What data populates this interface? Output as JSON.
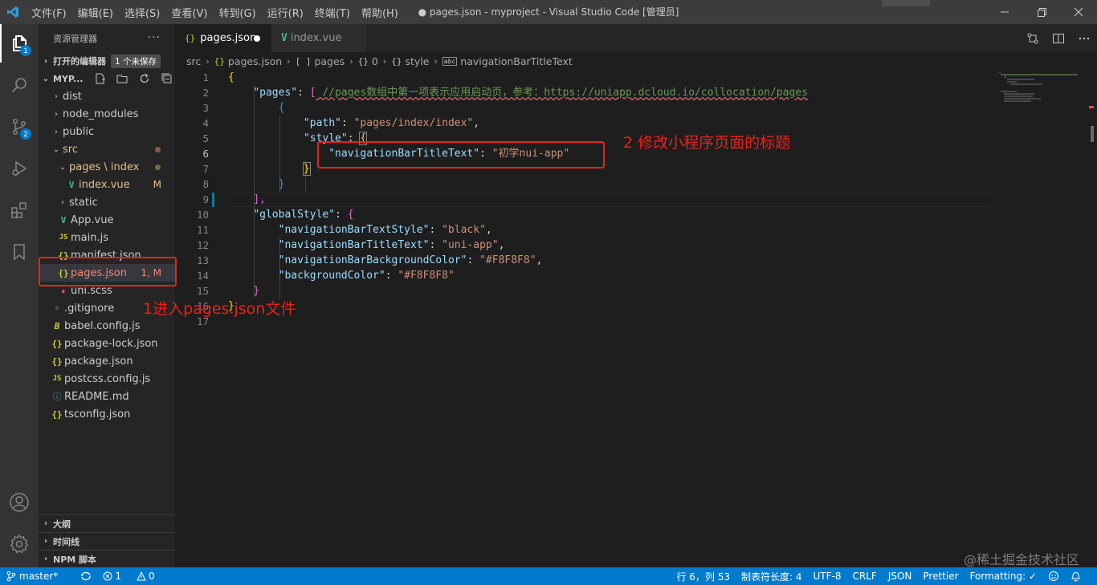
{
  "window": {
    "title": "● pages.json - myproject - Visual Studio Code [管理员]",
    "menu": [
      "文件(F)",
      "编辑(E)",
      "选择(S)",
      "查看(V)",
      "转到(G)",
      "运行(R)",
      "终端(T)",
      "帮助(H)"
    ]
  },
  "activitybar": {
    "explorer_badge": "1",
    "scm_badge": "2"
  },
  "sidebar": {
    "header": "资源管理器",
    "more": "···",
    "open_editors_label": "打开的编辑器",
    "unsaved_badge": "1 个未保存",
    "project_label": "MYP...",
    "tree": [
      {
        "label": "dist",
        "arrow": "›",
        "icon": "",
        "status": ""
      },
      {
        "label": "node_modules",
        "arrow": "›",
        "icon": "",
        "status": ""
      },
      {
        "label": "public",
        "arrow": "›",
        "icon": "",
        "status": ""
      },
      {
        "label": "src",
        "arrow": "⌄",
        "icon": "",
        "status": ""
      },
      {
        "label": "pages \\ index",
        "arrow": "⌄",
        "icon": "",
        "status": ""
      },
      {
        "label": "index.vue",
        "arrow": "",
        "icon": "V",
        "status": "M"
      },
      {
        "label": "static",
        "arrow": "›",
        "icon": "",
        "status": ""
      },
      {
        "label": "App.vue",
        "arrow": "",
        "icon": "V",
        "status": ""
      },
      {
        "label": "main.js",
        "arrow": "",
        "icon": "JS",
        "status": ""
      },
      {
        "label": "manifest.json",
        "arrow": "",
        "icon": "{}",
        "status": ""
      },
      {
        "label": "pages.json",
        "arrow": "",
        "icon": "{}",
        "status": "1, M"
      },
      {
        "label": "uni.scss",
        "arrow": "",
        "icon": "𝓈",
        "status": ""
      },
      {
        "label": ".gitignore",
        "arrow": "",
        "icon": "◆",
        "status": ""
      },
      {
        "label": "babel.config.js",
        "arrow": "",
        "icon": "B",
        "status": ""
      },
      {
        "label": "package-lock.json",
        "arrow": "",
        "icon": "{}",
        "status": ""
      },
      {
        "label": "package.json",
        "arrow": "",
        "icon": "{}",
        "status": ""
      },
      {
        "label": "postcss.config.js",
        "arrow": "",
        "icon": "JS",
        "status": ""
      },
      {
        "label": "README.md",
        "arrow": "",
        "icon": "ⓘ",
        "status": ""
      },
      {
        "label": "tsconfig.json",
        "arrow": "",
        "icon": "{}",
        "status": ""
      }
    ],
    "bottom_sections": [
      "大纲",
      "时间线",
      "NPM 脚本"
    ]
  },
  "editor": {
    "tabs": [
      {
        "icon": "{}",
        "label": "pages.json",
        "active": true,
        "dirty": true
      },
      {
        "icon": "V",
        "label": "index.vue",
        "active": false,
        "dirty": false
      }
    ],
    "breadcrumb": [
      "src",
      "pages.json",
      "pages",
      "0",
      "style",
      "navigationBarTitleText"
    ],
    "breadcrumb_icons": [
      "{}",
      "[ ]",
      "{}",
      "{}",
      "abc"
    ],
    "code": {
      "line_numbers": [
        "1",
        "2",
        "3",
        "4",
        "5",
        "6",
        "7",
        "8",
        "9",
        "10",
        "11",
        "12",
        "13",
        "14",
        "15",
        "16",
        "17"
      ],
      "l1": "{",
      "l2_key": "\"pages\"",
      "l2_colon": ": ",
      "l2_bracket": "[",
      "l2_comment": " //pages数组中第一项表示应用启动页，参考：https://uniapp.dcloud.io/collocation/pages",
      "l3": "{",
      "l4_key": "\"path\"",
      "l4_val": "\"pages/index/index\"",
      "l5_key": "\"style\"",
      "l5_brace": "{",
      "l6_key": "\"navigationBarTitleText\"",
      "l6_val": "\"初学nui-app\"",
      "l7": "}",
      "l8": "}",
      "l9": "],",
      "l10_key": "\"globalStyle\"",
      "l10_brace": "{",
      "l11_key": "\"navigationBarTextStyle\"",
      "l11_val": "\"black\"",
      "l12_key": "\"navigationBarTitleText\"",
      "l12_val": "\"uni-app\"",
      "l13_key": "\"navigationBarBackgroundColor\"",
      "l13_val": "\"#F8F8F8\"",
      "l14_key": "\"backgroundColor\"",
      "l14_val": "\"#F8F8F8\"",
      "l15": "}",
      "l16": "}"
    }
  },
  "annotations": {
    "step1": "1进入pages.json文件",
    "step2": "2 修改小程序页面的标题",
    "color": "#e5231b"
  },
  "statusbar": {
    "branch": "master*",
    "sync_icon": "sync-icon",
    "errors": "1",
    "warnings": "0",
    "position": "行 6，列 53",
    "indent": "制表符长度: 4",
    "encoding": "UTF-8",
    "eol": "CRLF",
    "language": "JSON",
    "prettier": "Prettier",
    "formatting": "Formatting: ✓"
  },
  "watermark": "@稀土掘金技术社区",
  "colors": {
    "accent": "#007acc",
    "titlebar": "#3c3c3c",
    "activitybar": "#333333",
    "sidebar": "#252526",
    "editor": "#1e1e1e"
  }
}
